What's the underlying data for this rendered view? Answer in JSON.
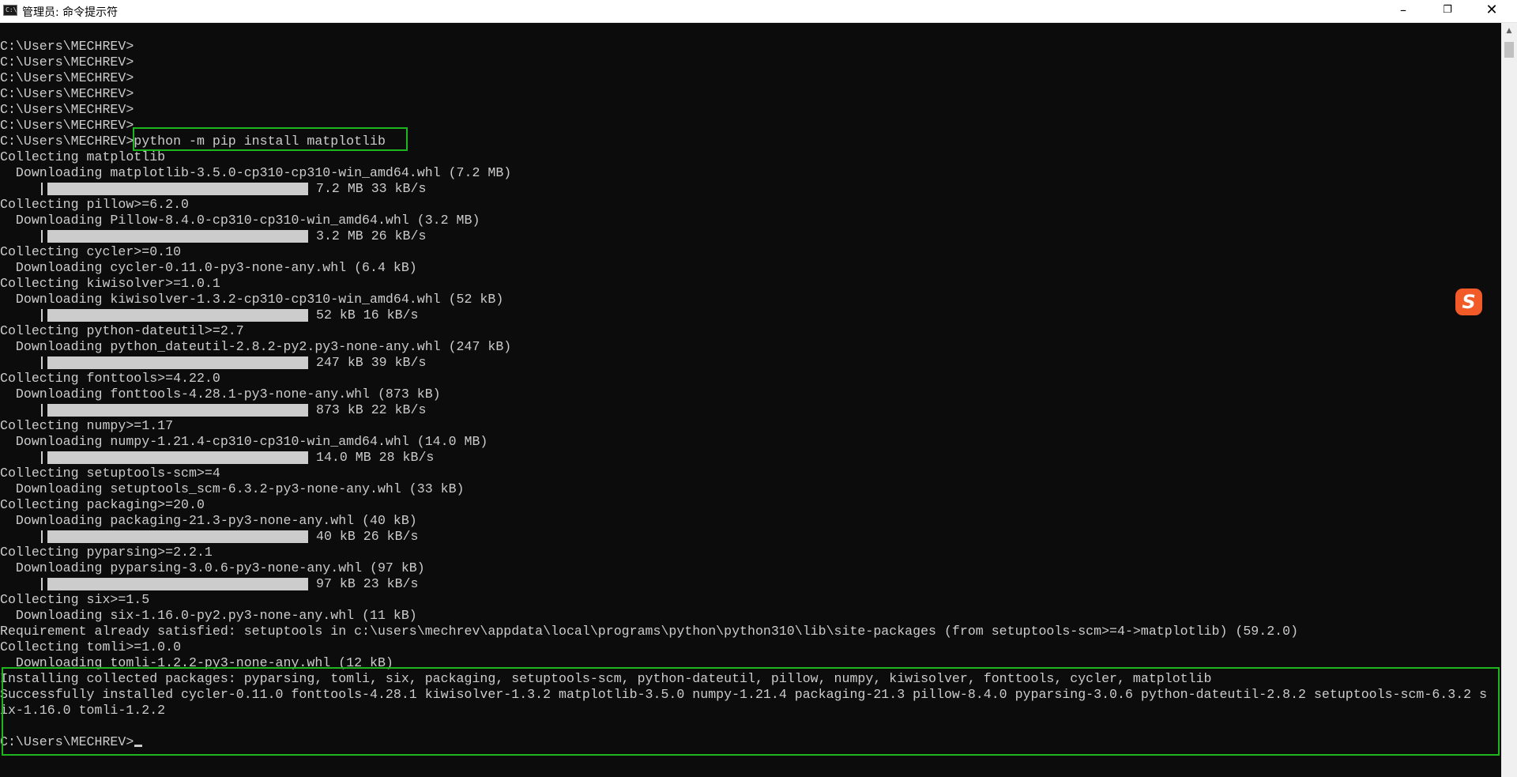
{
  "window": {
    "title": "管理员: 命令提示符",
    "icon_label": "C:\\_"
  },
  "controls": {
    "minimize": "–",
    "maximize": "❐",
    "close": "✕"
  },
  "ime": {
    "label": "S"
  },
  "terminal": {
    "lines": [
      "C:\\Users\\MECHREV>",
      "C:\\Users\\MECHREV>",
      "C:\\Users\\MECHREV>",
      "C:\\Users\\MECHREV>",
      "C:\\Users\\MECHREV>",
      "C:\\Users\\MECHREV>",
      "C:\\Users\\MECHREV>python -m pip install matplotlib",
      "Collecting matplotlib",
      "  Downloading matplotlib-3.5.0-cp310-cp310-win_amd64.whl (7.2 MB)",
      "7.2 MB 33 kB/s",
      "Collecting pillow>=6.2.0",
      "  Downloading Pillow-8.4.0-cp310-cp310-win_amd64.whl (3.2 MB)",
      "3.2 MB 26 kB/s",
      "Collecting cycler>=0.10",
      "  Downloading cycler-0.11.0-py3-none-any.whl (6.4 kB)",
      "Collecting kiwisolver>=1.0.1",
      "  Downloading kiwisolver-1.3.2-cp310-cp310-win_amd64.whl (52 kB)",
      "52 kB 16 kB/s",
      "Collecting python-dateutil>=2.7",
      "  Downloading python_dateutil-2.8.2-py2.py3-none-any.whl (247 kB)",
      "247 kB 39 kB/s",
      "Collecting fonttools>=4.22.0",
      "  Downloading fonttools-4.28.1-py3-none-any.whl (873 kB)",
      "873 kB 22 kB/s",
      "Collecting numpy>=1.17",
      "  Downloading numpy-1.21.4-cp310-cp310-win_amd64.whl (14.0 MB)",
      "14.0 MB 28 kB/s",
      "Collecting setuptools-scm>=4",
      "  Downloading setuptools_scm-6.3.2-py3-none-any.whl (33 kB)",
      "Collecting packaging>=20.0",
      "  Downloading packaging-21.3-py3-none-any.whl (40 kB)",
      "40 kB 26 kB/s",
      "Collecting pyparsing>=2.2.1",
      "  Downloading pyparsing-3.0.6-py3-none-any.whl (97 kB)",
      "97 kB 23 kB/s",
      "Collecting six>=1.5",
      "  Downloading six-1.16.0-py2.py3-none-any.whl (11 kB)",
      "Requirement already satisfied: setuptools in c:\\users\\mechrev\\appdata\\local\\programs\\python\\python310\\lib\\site-packages (from setuptools-scm>=4->matplotlib) (59.2.0)",
      "Collecting tomli>=1.0.0",
      "  Downloading tomli-1.2.2-py3-none-any.whl (12 kB)",
      "Installing collected packages: pyparsing, tomli, six, packaging, setuptools-scm, python-dateutil, pillow, numpy, kiwisolver, fonttools, cycler, matplotlib",
      "Successfully installed cycler-0.11.0 fonttools-4.28.1 kiwisolver-1.3.2 matplotlib-3.5.0 numpy-1.21.4 packaging-21.3 pillow-8.4.0 pyparsing-3.0.6 python-dateutil-2.8.2 setuptools-scm-6.3.2 s",
      "ix-1.16.0 tomli-1.2.2",
      "",
      "C:\\Users\\MECHREV>"
    ]
  }
}
